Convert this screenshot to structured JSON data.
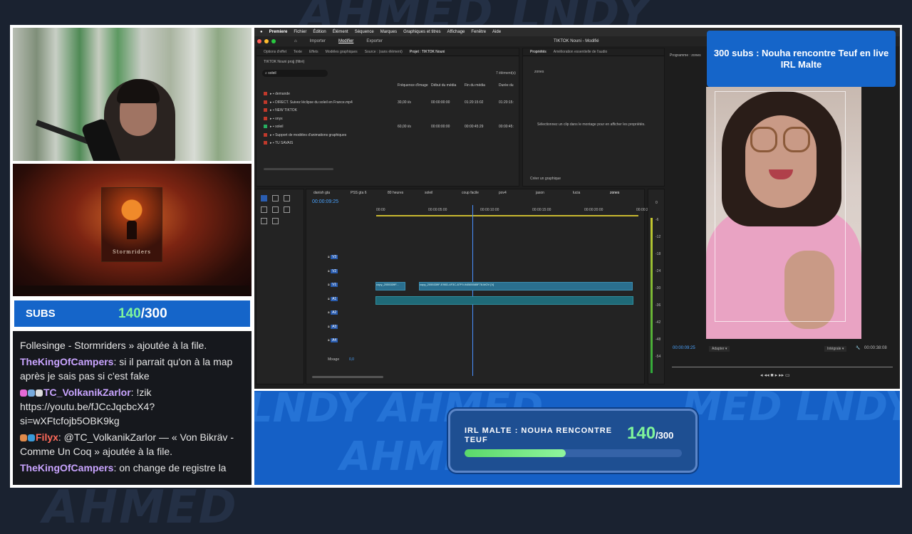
{
  "subs_widget": {
    "label": "SUBS",
    "current": "140",
    "separator_goal": "/300"
  },
  "chat": {
    "messages": [
      {
        "user": "",
        "text": "Follesinge - Stormriders » ajoutée à la file."
      },
      {
        "user": "TheKingOfCampers",
        "text": ": si il parrait qu'on à la map après je sais pas si c'est fake"
      },
      {
        "user": "TC_VolkanikZarlor",
        "text": ": !zik https://youtu.be/fJCcJqcbcX4?si=wXFtcfojb5OBK9kg"
      },
      {
        "user": "Filyx",
        "text": ": @TC_VolkanikZarlor — « Von Bikräv - Comme Un Coq » ajoutée à la file."
      },
      {
        "user": "TheKingOfCampers",
        "text": ": on change de registre la"
      }
    ]
  },
  "album": {
    "title": "Stormriders"
  },
  "premiere": {
    "menu": [
      "Premiere",
      "Fichier",
      "Édition",
      "Élément",
      "Séquence",
      "Marques",
      "Graphiques et titres",
      "Affichage",
      "Fenêtre",
      "Aide"
    ],
    "tabs": [
      "Importer",
      "Modifier",
      "Exporter"
    ],
    "window_title": "TIKTOK Nouni - Modifié",
    "panel_tabs": [
      "Options d'effet",
      "Texte",
      "Effets",
      "Modèles graphiques",
      "Source : (sans élément)",
      "Projet : TIKTOK Nouni"
    ],
    "project_name": "TIKTOK Nouni projj (filtré)",
    "search_value": "soleil",
    "items_count": "7 élément(s)",
    "columns": [
      "Fréquence d'image",
      "Début du média",
      "Fin du média",
      "Durée du"
    ],
    "rows": [
      {
        "name": "demande",
        "color": "#c0392b",
        "fps": "",
        "start": "",
        "end": "",
        "dur": ""
      },
      {
        "name": "DIRECT. Suivez léclipse du soleil en France.mp4",
        "color": "#c0392b",
        "fps": "30,00 i/s",
        "start": "00:00:00:00",
        "end": "01:20:15:02",
        "dur": "01:20:15:"
      },
      {
        "name": "NEW TIKTOK",
        "color": "#c0392b",
        "fps": "",
        "start": "",
        "end": "",
        "dur": ""
      },
      {
        "name": "onyx",
        "color": "#c0392b",
        "fps": "",
        "start": "",
        "end": "",
        "dur": ""
      },
      {
        "name": "soleil",
        "color": "#27ae60",
        "fps": "60,00 i/s",
        "start": "00:00:00:00",
        "end": "00:00:45:29",
        "dur": "00:00:45:"
      },
      {
        "name": "Support de modèles d'animations graphiques",
        "color": "#c0392b",
        "fps": "",
        "start": "",
        "end": "",
        "dur": ""
      },
      {
        "name": "TU SAVAIS",
        "color": "#c0392b",
        "fps": "",
        "start": "",
        "end": "",
        "dur": ""
      }
    ],
    "props_tabs": [
      "Propriétés",
      "Amélioration essentielle de l'audio"
    ],
    "props_item": "zones",
    "props_hint": "Sélectionnez un clip dans le montage pour en afficher les propriétés.",
    "create_graphic": "Créer un graphique",
    "program_label": "Programme : zones",
    "timeline_tabs": [
      "danish gta",
      "PSS gta 6",
      "80 heures",
      "soleil",
      "coup facile",
      "pov4",
      "jason",
      "lucia",
      "zones"
    ],
    "timecode": "00:00:09:25",
    "ruler": [
      "00:00",
      "00:00:05:00",
      "00:00:10:00",
      "00:00:15:00",
      "00:00:20:00",
      "00:00:2"
    ],
    "tracks_video": [
      "V3",
      "V2",
      "V1"
    ],
    "tracks_audio": [
      "A1",
      "A2",
      "A3",
      "A4"
    ],
    "mix_label": "Mixage",
    "mix_value": "0,0",
    "clip1": "copy_2055339F...",
    "clip2": "copy_2055339F-E90D-4F3C-87F9-94B05585F78.MOV [V]",
    "meter_ticks": [
      "0",
      "-6",
      "-12",
      "-18",
      "-24",
      "-30",
      "-36",
      "-42",
      "-48",
      "-54"
    ],
    "program_timecode": "00:00:09:25",
    "fit": "Adapter",
    "quality": "Intégrale",
    "duration": "00:00:38:08"
  },
  "overlay_box": {
    "text": "300 subs : Nouha rencontre Teuf en live IRL Malte"
  },
  "goal": {
    "title": "IRL MALTE : NOUHA RENCONTRE TEUF",
    "current": "140",
    "max": "/300",
    "progress": 0.4667
  },
  "colors": {
    "accent": "#1565c9",
    "green": "#7ff59b",
    "chat_user": "#c9a4ff"
  }
}
